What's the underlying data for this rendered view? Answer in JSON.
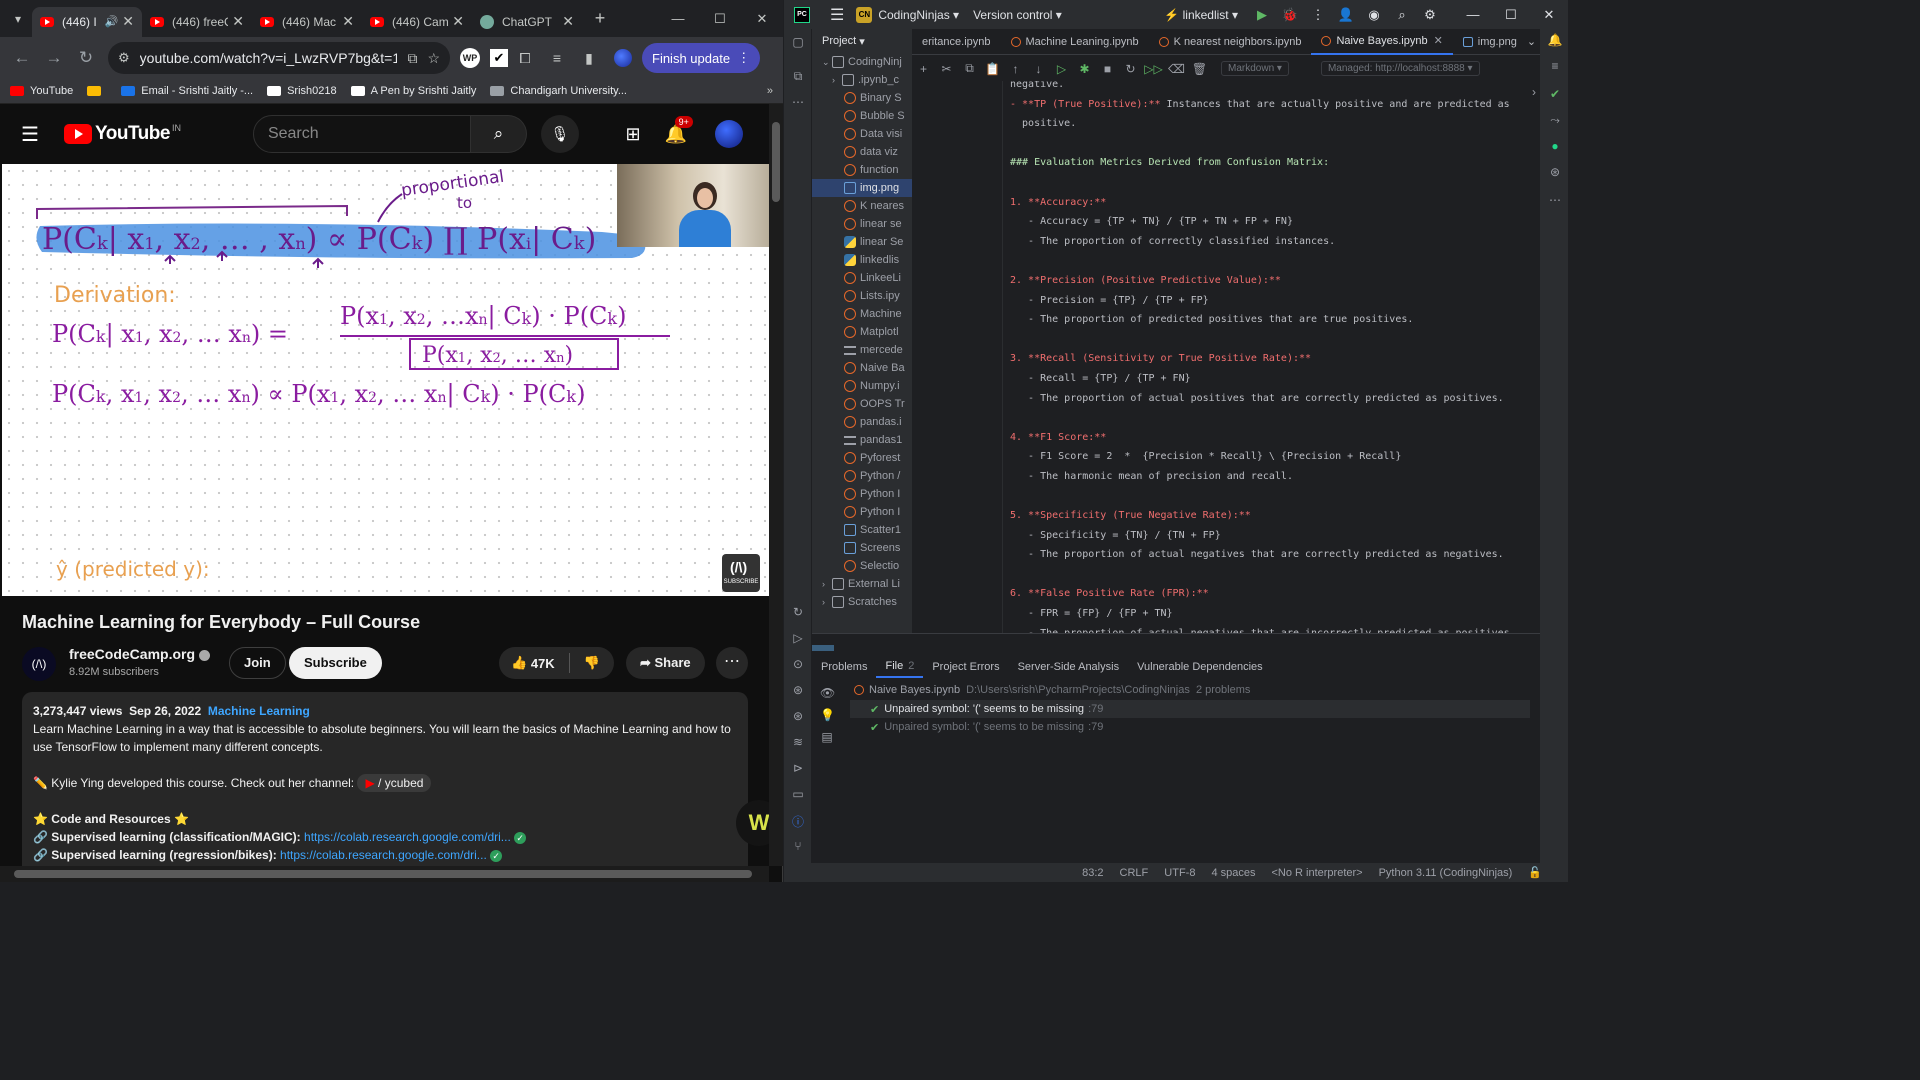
{
  "browser": {
    "tabs": [
      {
        "title": "(446) I",
        "type": "youtube"
      },
      {
        "title": "(446) freeC",
        "type": "youtube"
      },
      {
        "title": "(446) Mac",
        "type": "youtube"
      },
      {
        "title": "(446) Cam",
        "type": "youtube"
      },
      {
        "title": "ChatGPT",
        "type": "chatgpt"
      }
    ],
    "url": "youtube.com/watch?v=i_LwzRVP7bg&t=118s",
    "finish_update": "Finish update",
    "bookmarks": [
      {
        "label": "YouTube",
        "color": "#ff0000"
      },
      {
        "label": "",
        "color": "#fbbc04"
      },
      {
        "label": "Email - Srishti Jaitly -...",
        "color": "#1a73e8"
      },
      {
        "label": "Srish0218",
        "color": "#ffffff"
      },
      {
        "label": "A Pen by Srishti Jaitly",
        "color": "#ffffff"
      },
      {
        "label": "Chandigarh University...",
        "color": "#9aa0a6"
      }
    ]
  },
  "youtube": {
    "logo": "YouTube",
    "country": "IN",
    "search_placeholder": "Search",
    "notif_count": "9+",
    "video_title": "Machine Learning for Everybody – Full Course",
    "channel_name": "freeCodeCamp.org",
    "subscribers": "8.92M subscribers",
    "join": "Join",
    "subscribe": "Subscribe",
    "likes": "47K",
    "share": "Share",
    "description": {
      "views": "3,273,447 views",
      "date": "Sep 26, 2022",
      "tag": "Machine Learning",
      "text": "Learn Machine Learning in a way that is accessible to absolute beginners. You will learn the basics of Machine Learning and how to use TensorFlow to implement many different concepts.",
      "credit_prefix": "Kylie Ying developed this course. Check out her channel:",
      "channel_chip": "/ ycubed",
      "resources": "Code and Resources",
      "link1_label": "Supervised learning (classification/MAGIC):",
      "link1": "https://colab.research.google.com/dri...",
      "link2_label": "Supervised learning (regression/bikes):",
      "link2": "https://colab.research.google.com/dri..."
    },
    "whiteboard": {
      "proportional": "proportional",
      "to": "to",
      "derivation": "Derivation:",
      "predicted": "ŷ (predicted y):"
    }
  },
  "ide": {
    "logo": "PC",
    "project_badge": "CN",
    "project_name": "CodingNinjas",
    "vcs": "Version control",
    "branch": "linkedlist",
    "project_panel_title": "Project",
    "tree_root": "CodingNinj",
    "tree": [
      {
        "label": ".ipynb_c",
        "kind": "folder"
      },
      {
        "label": "Binary S",
        "kind": "jup"
      },
      {
        "label": "Bubble S",
        "kind": "jup"
      },
      {
        "label": "Data visi",
        "kind": "jup"
      },
      {
        "label": "data viz",
        "kind": "jup"
      },
      {
        "label": "function",
        "kind": "jup"
      },
      {
        "label": "img.png",
        "kind": "img"
      },
      {
        "label": "K neares",
        "kind": "jup"
      },
      {
        "label": "linear se",
        "kind": "jup"
      },
      {
        "label": "linear Se",
        "kind": "py"
      },
      {
        "label": "linkedlis",
        "kind": "py"
      },
      {
        "label": "LinkeeLi",
        "kind": "jup"
      },
      {
        "label": "Lists.ipy",
        "kind": "jup"
      },
      {
        "label": "Machine",
        "kind": "jup"
      },
      {
        "label": "Matplotl",
        "kind": "jup"
      },
      {
        "label": "mercede",
        "kind": "txt"
      },
      {
        "label": "Naive Ba",
        "kind": "jup"
      },
      {
        "label": "Numpy.i",
        "kind": "jup"
      },
      {
        "label": "OOPS Tr",
        "kind": "jup"
      },
      {
        "label": "pandas.i",
        "kind": "jup"
      },
      {
        "label": "pandas1",
        "kind": "txt"
      },
      {
        "label": "Pyforest",
        "kind": "jup"
      },
      {
        "label": "Python /",
        "kind": "jup"
      },
      {
        "label": "Python I",
        "kind": "jup"
      },
      {
        "label": "Python I",
        "kind": "jup"
      },
      {
        "label": "Scatter1",
        "kind": "img"
      },
      {
        "label": "Screens",
        "kind": "img"
      },
      {
        "label": "Selectio",
        "kind": "jup"
      },
      {
        "label": "External Li",
        "kind": "ext"
      },
      {
        "label": "Scratches",
        "kind": "ext"
      }
    ],
    "editor_tabs": [
      {
        "label": "eritance.ipynb",
        "active": false
      },
      {
        "label": "Machine Leaning.ipynb",
        "active": false
      },
      {
        "label": "K nearest neighbors.ipynb",
        "active": false
      },
      {
        "label": "Naive Bayes.ipynb",
        "active": true
      },
      {
        "label": "img.png",
        "active": false
      }
    ],
    "cell_type": "Markdown",
    "managed": "Managed: http://localhost:8888",
    "code_lines": [
      {
        "t": "negative.",
        "c": ""
      },
      {
        "t": "- **TP (True Positive):** Instances that are actually positive and are predicted as",
        "c": "bold"
      },
      {
        "t": "  positive.",
        "c": ""
      },
      {
        "t": "",
        "c": ""
      },
      {
        "t": "### Evaluation Metrics Derived from Confusion Matrix:",
        "c": "head"
      },
      {
        "t": "",
        "c": ""
      },
      {
        "t": "1. **Accuracy:**",
        "c": "num"
      },
      {
        "t": "   - Accuracy = {TP + TN} / {TP + TN + FP + FN}",
        "c": ""
      },
      {
        "t": "   - The proportion of correctly classified instances.",
        "c": ""
      },
      {
        "t": "",
        "c": ""
      },
      {
        "t": "2. **Precision (Positive Predictive Value):**",
        "c": "num"
      },
      {
        "t": "   - Precision = {TP} / {TP + FP}",
        "c": ""
      },
      {
        "t": "   - The proportion of predicted positives that are true positives.",
        "c": ""
      },
      {
        "t": "",
        "c": ""
      },
      {
        "t": "3. **Recall (Sensitivity or True Positive Rate):**",
        "c": "num"
      },
      {
        "t": "   - Recall = {TP} / {TP + FN}",
        "c": ""
      },
      {
        "t": "   - The proportion of actual positives that are correctly predicted as positives.",
        "c": ""
      },
      {
        "t": "",
        "c": ""
      },
      {
        "t": "4. **F1 Score:**",
        "c": "num"
      },
      {
        "t": "   - F1 Score = 2  *  {Precision * Recall} \\ {Precision + Recall}",
        "c": ""
      },
      {
        "t": "   - The harmonic mean of precision and recall.",
        "c": ""
      },
      {
        "t": "",
        "c": ""
      },
      {
        "t": "5. **Specificity (True Negative Rate):**",
        "c": "num"
      },
      {
        "t": "   - Specificity = {TN} / {TN + FP}",
        "c": ""
      },
      {
        "t": "   - The proportion of actual negatives that are correctly predicted as negatives.",
        "c": ""
      },
      {
        "t": "",
        "c": ""
      },
      {
        "t": "6. **False Positive Rate (FPR):**",
        "c": "num"
      },
      {
        "t": "   - FPR = {FP} / {FP + TN}",
        "c": ""
      },
      {
        "t": "   - The proportion of actual negatives that are incorrectly predicted as positives.",
        "c": ""
      }
    ],
    "bottom_tabs": [
      {
        "label": "Problems",
        "count": ""
      },
      {
        "label": "File",
        "count": "2"
      },
      {
        "label": "Project Errors",
        "count": ""
      },
      {
        "label": "Server-Side Analysis",
        "count": ""
      },
      {
        "label": "Vulnerable Dependencies",
        "count": ""
      }
    ],
    "problem_file": "Naive Bayes.ipynb",
    "problem_path": "D:\\Users\\srish\\PycharmProjects\\CodingNinjas",
    "problem_count": "2 problems",
    "problems": [
      {
        "text": "Unpaired symbol: '(' seems to be missing",
        "line": ":79"
      },
      {
        "text": "Unpaired symbol: '(' seems to be missing",
        "line": ":79"
      }
    ],
    "status": {
      "position": "83:2",
      "line_sep": "CRLF",
      "encoding": "UTF-8",
      "indent": "4 spaces",
      "r_interp": "<No R interpreter>",
      "interp": "Python 3.11 (CodingNinjas)"
    }
  }
}
